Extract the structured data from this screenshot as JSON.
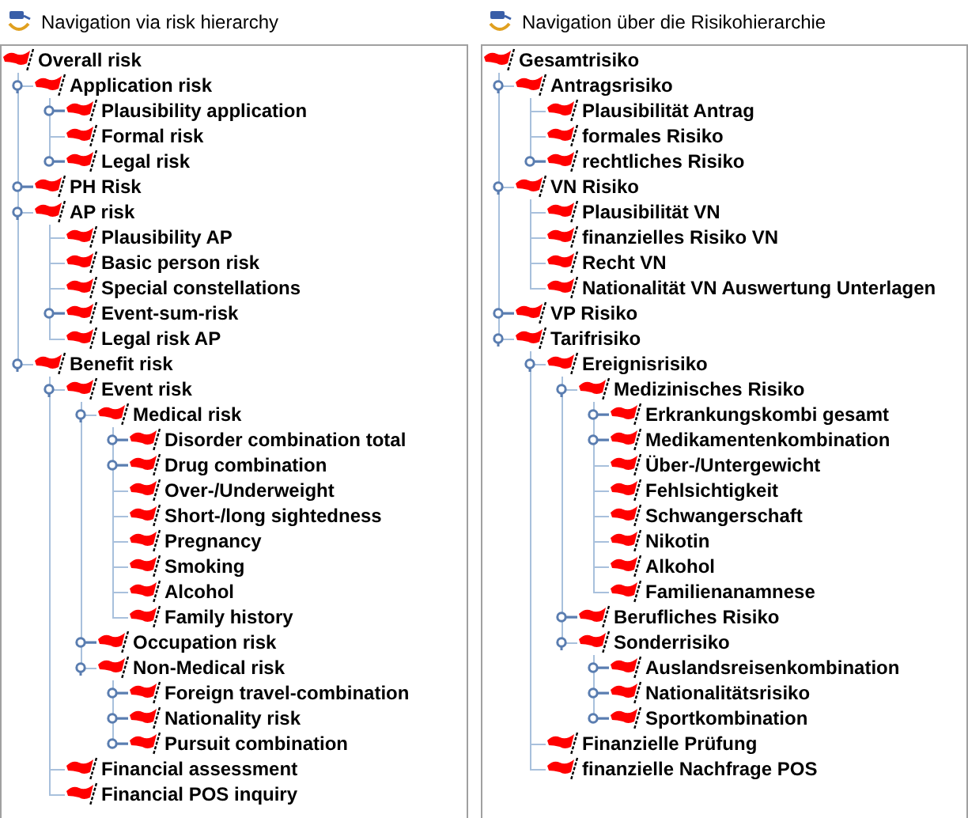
{
  "panels": [
    {
      "title": "Navigation via risk hierarchy",
      "tree": {
        "label": "Overall risk",
        "kind": "root",
        "children": [
          {
            "label": "Application risk",
            "kind": "branch",
            "expanded": true,
            "children": [
              {
                "label": "Plausibility application",
                "kind": "branch",
                "expanded": false
              },
              {
                "label": "Formal risk",
                "kind": "leaf"
              },
              {
                "label": "Legal risk",
                "kind": "branch",
                "expanded": false
              }
            ]
          },
          {
            "label": "PH Risk",
            "kind": "branch",
            "expanded": false
          },
          {
            "label": "AP risk",
            "kind": "branch",
            "expanded": true,
            "children": [
              {
                "label": "Plausibility AP",
                "kind": "leaf"
              },
              {
                "label": "Basic person risk",
                "kind": "leaf"
              },
              {
                "label": "Special constellations",
                "kind": "leaf"
              },
              {
                "label": "Event-sum-risk",
                "kind": "branch",
                "expanded": false
              },
              {
                "label": "Legal risk AP",
                "kind": "leaf"
              }
            ]
          },
          {
            "label": "Benefit risk",
            "kind": "branch",
            "expanded": true,
            "children": [
              {
                "label": "Event risk",
                "kind": "branch",
                "expanded": true,
                "children": [
                  {
                    "label": "Medical risk",
                    "kind": "branch",
                    "expanded": true,
                    "children": [
                      {
                        "label": "Disorder combination total",
                        "kind": "branch",
                        "expanded": false
                      },
                      {
                        "label": "Drug combination",
                        "kind": "branch",
                        "expanded": false
                      },
                      {
                        "label": "Over-/Underweight",
                        "kind": "leaf"
                      },
                      {
                        "label": "Short-/long sightedness",
                        "kind": "leaf"
                      },
                      {
                        "label": "Pregnancy",
                        "kind": "leaf"
                      },
                      {
                        "label": "Smoking",
                        "kind": "leaf"
                      },
                      {
                        "label": "Alcohol",
                        "kind": "leaf"
                      },
                      {
                        "label": "Family history",
                        "kind": "leaf"
                      }
                    ]
                  },
                  {
                    "label": "Occupation risk",
                    "kind": "branch",
                    "expanded": false
                  },
                  {
                    "label": "Non-Medical risk",
                    "kind": "branch",
                    "expanded": true,
                    "children": [
                      {
                        "label": "Foreign travel-combination",
                        "kind": "branch",
                        "expanded": false
                      },
                      {
                        "label": "Nationality risk",
                        "kind": "branch",
                        "expanded": false
                      },
                      {
                        "label": "Pursuit combination",
                        "kind": "branch",
                        "expanded": false
                      }
                    ]
                  }
                ]
              },
              {
                "label": "Financial assessment",
                "kind": "leaf"
              },
              {
                "label": "Financial POS inquiry",
                "kind": "leaf"
              }
            ]
          }
        ]
      }
    },
    {
      "title": "Navigation über die Risikohierarchie",
      "tree": {
        "label": "Gesamtrisiko",
        "kind": "root",
        "children": [
          {
            "label": "Antragsrisiko",
            "kind": "branch",
            "expanded": true,
            "children": [
              {
                "label": "Plausibilität Antrag",
                "kind": "leaf"
              },
              {
                "label": "formales Risiko",
                "kind": "leaf"
              },
              {
                "label": "rechtliches Risiko",
                "kind": "branch",
                "expanded": false
              }
            ]
          },
          {
            "label": "VN Risiko",
            "kind": "branch",
            "expanded": true,
            "children": [
              {
                "label": "Plausibilität VN",
                "kind": "leaf"
              },
              {
                "label": "finanzielles Risiko VN",
                "kind": "leaf"
              },
              {
                "label": "Recht VN",
                "kind": "leaf"
              },
              {
                "label": "Nationalität VN Auswertung Unterlagen",
                "kind": "leaf"
              }
            ]
          },
          {
            "label": "VP Risiko",
            "kind": "branch",
            "expanded": false
          },
          {
            "label": "Tarifrisiko",
            "kind": "branch",
            "expanded": true,
            "children": [
              {
                "label": "Ereignisrisiko",
                "kind": "branch",
                "expanded": true,
                "children": [
                  {
                    "label": "Medizinisches Risiko",
                    "kind": "branch",
                    "expanded": true,
                    "children": [
                      {
                        "label": "Erkrankungskombi gesamt",
                        "kind": "branch",
                        "expanded": false
                      },
                      {
                        "label": "Medikamentenkombination",
                        "kind": "branch",
                        "expanded": false
                      },
                      {
                        "label": "Über-/Untergewicht",
                        "kind": "leaf"
                      },
                      {
                        "label": "Fehlsichtigkeit",
                        "kind": "leaf"
                      },
                      {
                        "label": "Schwangerschaft",
                        "kind": "leaf"
                      },
                      {
                        "label": "Nikotin",
                        "kind": "leaf"
                      },
                      {
                        "label": "Alkohol",
                        "kind": "leaf"
                      },
                      {
                        "label": "Familienanamnese",
                        "kind": "leaf"
                      }
                    ]
                  },
                  {
                    "label": "Berufliches Risiko",
                    "kind": "branch",
                    "expanded": false
                  },
                  {
                    "label": "Sonderrisiko",
                    "kind": "branch",
                    "expanded": true,
                    "children": [
                      {
                        "label": "Auslandsreisenkombination",
                        "kind": "branch",
                        "expanded": false
                      },
                      {
                        "label": "Nationalitätsrisiko",
                        "kind": "branch",
                        "expanded": false
                      },
                      {
                        "label": "Sportkombination",
                        "kind": "branch",
                        "expanded": false
                      }
                    ]
                  }
                ]
              },
              {
                "label": "Finanzielle Prüfung",
                "kind": "leaf"
              },
              {
                "label": "finanzielle Nachfrage POS",
                "kind": "leaf"
              }
            ]
          }
        ]
      }
    }
  ]
}
